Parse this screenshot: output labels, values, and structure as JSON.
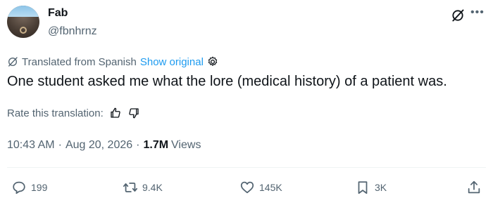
{
  "author": {
    "name": "Fab",
    "handle": "@fbnhrnz"
  },
  "icons": {
    "grok": "grok-icon",
    "more": "more-icon",
    "translate": "translate-icon",
    "settings": "settings-icon",
    "thumbs_up": "thumbs-up-icon",
    "thumbs_down": "thumbs-down-icon",
    "reply": "reply-icon",
    "repost": "repost-icon",
    "like": "heart-icon",
    "bookmark": "bookmark-icon",
    "share": "share-icon"
  },
  "translation": {
    "label": "Translated from Spanish",
    "show_original": "Show original"
  },
  "tweet": {
    "text": "One student asked me what the lore (medical history) of a patient was."
  },
  "rating": {
    "label": "Rate this translation:"
  },
  "meta": {
    "time": "10:43 AM",
    "separator": "·",
    "date": "Aug 20, 2026",
    "views_count": "1.7M",
    "views_label": "Views"
  },
  "actions": {
    "replies": "199",
    "reposts": "9.4K",
    "likes": "145K",
    "bookmarks": "3K"
  },
  "colors": {
    "text_primary": "#0f1419",
    "text_secondary": "#536471",
    "link": "#1d9bf0",
    "divider": "#eff3f4"
  }
}
